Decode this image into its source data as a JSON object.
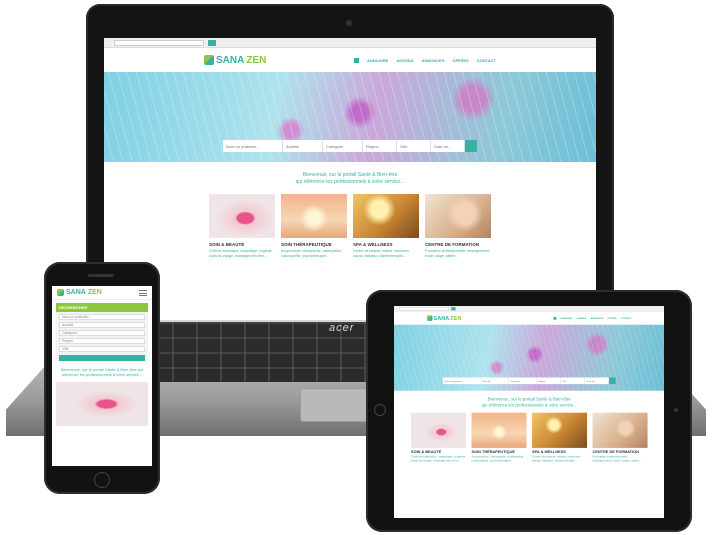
{
  "laptop": {
    "brand": "acer"
  },
  "site": {
    "logo": {
      "sana": "SANA",
      "zen": "ZEN"
    },
    "topbar": {
      "search_placeholder": "",
      "user_text": ""
    },
    "nav": [
      "Annuaire",
      "Agenda",
      "Annonces",
      "Offres",
      "Contact"
    ],
    "search_fields": [
      "Nom ou praticien...",
      "Activité",
      "Catégorie",
      "Région",
      "Ville",
      "Date de..."
    ],
    "welcome_line1": "Bienvenue, sur le portail Santé & Bien-être",
    "welcome_line2": "qui référence les professionnels à votre service...",
    "cards": [
      {
        "title": "SOIN & BEAUTÉ",
        "desc": "Coiffure esthétique, maquillage, onglerie, soins du visage, massage bien-être..."
      },
      {
        "title": "SOIN THÉRAPEUTIQUE",
        "desc": "Acupuncture, chiropractie, ostéopathie, naturopathie, psychothérapie..."
      },
      {
        "title": "SPA & WELLNESS",
        "desc": "Centre de beauté, institut, hammam, sauna, thalasso, balnéothérapie..."
      },
      {
        "title": "CENTRE DE FORMATION",
        "desc": "Formation professionnelle, enseignement, école, stage, atelier..."
      }
    ]
  },
  "mobile": {
    "panel_title": "RECHERCHER",
    "fields": [
      "Nom ou praticien...",
      "Activité",
      "Catégorie",
      "Région",
      "Ville"
    ],
    "welcome": "Bienvenue, sur le portail Santé & Bien-être qui référence les professionnels à votre service..."
  }
}
